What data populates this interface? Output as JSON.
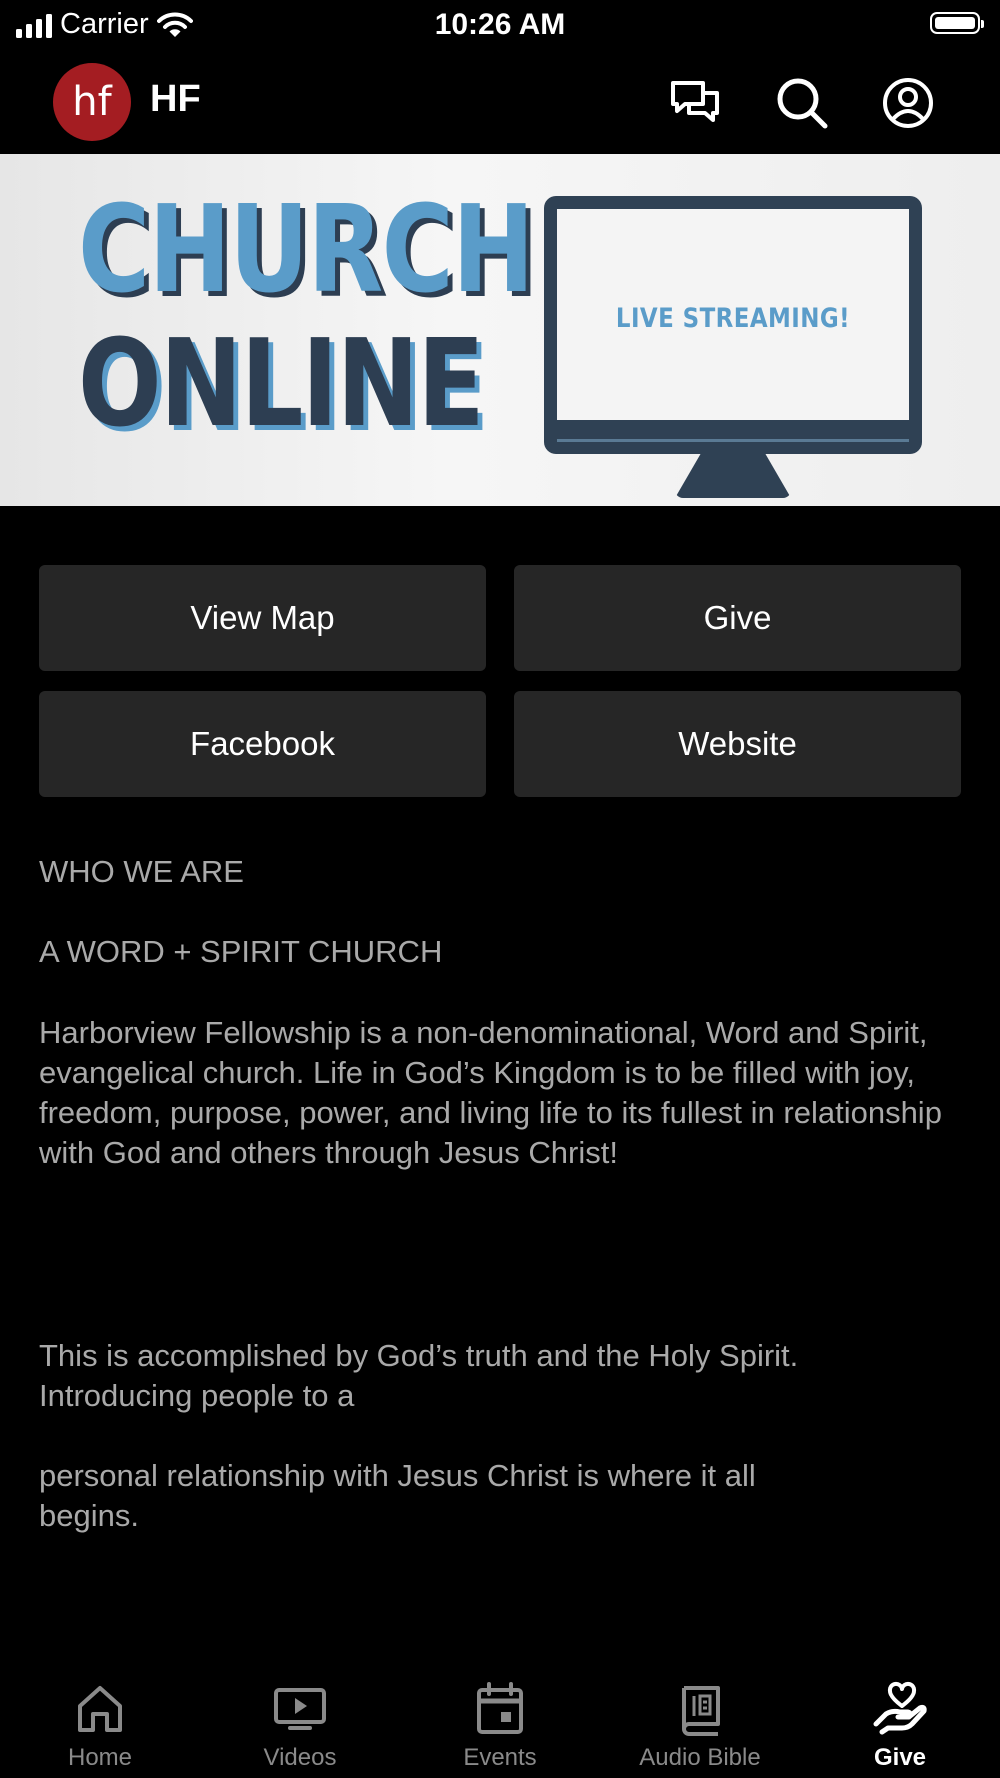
{
  "status_bar": {
    "carrier": "Carrier",
    "time": "10:26 AM"
  },
  "header": {
    "logo_text": "hf",
    "title": "HF",
    "logo_color": "#a41d22"
  },
  "banner": {
    "line1": "CHURCH",
    "line2": "ONLINE",
    "screen_text": "LIVE STREAMING!",
    "accent_blue": "#5a9cc9",
    "dark_blue": "#2d3e52"
  },
  "buttons": {
    "view_map": "View Map",
    "give": "Give",
    "facebook": "Facebook",
    "website": "Website"
  },
  "content": {
    "heading": "WHO WE ARE",
    "subheading": "A WORD + SPIRIT CHURCH",
    "paragraph1": "Harborview Fellowship is a non-denominational, Word and Spirit, evangelical church. Life in God’s Kingdom is to be filled with joy, freedom, purpose, power, and living life to its fullest in relationship with God and others through Jesus Christ!",
    "paragraph2": "This is accomplished by God’s truth and the Holy Spirit. Introducing people to a",
    "paragraph3": "personal relationship with Jesus Christ is where it all begins."
  },
  "tabs": [
    {
      "label": "Home",
      "icon": "home-icon",
      "active": false
    },
    {
      "label": "Videos",
      "icon": "video-icon",
      "active": false
    },
    {
      "label": "Events",
      "icon": "calendar-icon",
      "active": false
    },
    {
      "label": "Audio Bible",
      "icon": "bible-icon",
      "active": false
    },
    {
      "label": "Give",
      "icon": "give-heart-hand-icon",
      "active": true
    }
  ],
  "colors": {
    "background": "#000000",
    "button_bg": "#262626",
    "body_text": "#a9a9a9",
    "tab_inactive": "#8a8a8a"
  }
}
